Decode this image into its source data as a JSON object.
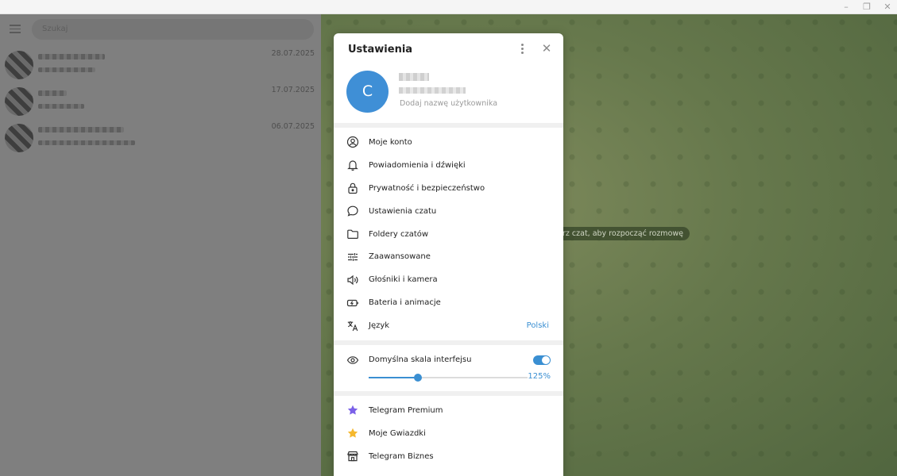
{
  "window": {
    "minimize_glyph": "–",
    "restore_glyph": "❐",
    "close_glyph": "✕"
  },
  "left": {
    "search_placeholder": "Szukaj",
    "chats": [
      {
        "date": "28.07.2025"
      },
      {
        "date": "17.07.2025"
      },
      {
        "date": "06.07.2025"
      }
    ]
  },
  "chat_area": {
    "hint": "rz czat, aby rozpocząć rozmowę"
  },
  "settings": {
    "title": "Ustawienia",
    "profile": {
      "avatar_letter": "C",
      "username_hint": "Dodaj nazwę użytkownika"
    },
    "items": [
      {
        "label": "Moje konto",
        "icon": "user-circle-icon"
      },
      {
        "label": "Powiadomienia i dźwięki",
        "icon": "bell-icon"
      },
      {
        "label": "Prywatność i bezpieczeństwo",
        "icon": "lock-icon"
      },
      {
        "label": "Ustawienia czatu",
        "icon": "chat-bubble-icon"
      },
      {
        "label": "Foldery czatów",
        "icon": "folder-icon"
      },
      {
        "label": "Zaawansowane",
        "icon": "sliders-icon"
      },
      {
        "label": "Głośniki i kamera",
        "icon": "speaker-icon"
      },
      {
        "label": "Bateria i animacje",
        "icon": "battery-icon"
      },
      {
        "label": "Język",
        "icon": "translate-icon",
        "value": "Polski"
      }
    ],
    "scale": {
      "label": "Domyślna skala interfejsu",
      "enabled": true,
      "percent_label": "125%",
      "slider_fraction": 0.31
    },
    "extras": [
      {
        "label": "Telegram Premium",
        "icon": "star-purple-icon"
      },
      {
        "label": "Moje Gwiazdki",
        "icon": "star-gold-icon"
      },
      {
        "label": "Telegram Biznes",
        "icon": "shop-icon"
      }
    ]
  },
  "colors": {
    "accent": "#3a8fd2",
    "avatar": "#3f8fd6",
    "premium": "#7b61e8",
    "stars": "#f5b82e"
  }
}
